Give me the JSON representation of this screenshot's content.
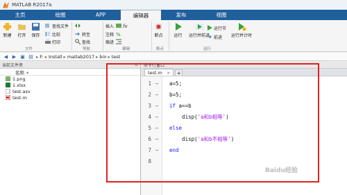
{
  "window": {
    "title": "MATLAB R2017a"
  },
  "tabs": [
    {
      "label": "主页",
      "active": false
    },
    {
      "label": "绘图",
      "active": false
    },
    {
      "label": "APP",
      "active": false
    },
    {
      "label": "编辑器",
      "active": true
    },
    {
      "label": "发布",
      "active": false
    },
    {
      "label": "视图",
      "active": false
    }
  ],
  "ribbon": {
    "new": "新建",
    "open": "打开",
    "save": "保存",
    "find_files": "查找文件",
    "compare": "比较",
    "print": "打印",
    "goto": "转至",
    "find": "查找",
    "insert": "插入",
    "comment": "注释",
    "indent": "缩进",
    "breakpoints": "断点",
    "run": "运行",
    "run_advance": "运行并前进",
    "run_section": "运行节",
    "advance": "前进",
    "run_time": "运行并计时",
    "group_file": "文件",
    "group_nav": "导航",
    "group_edit": "编辑",
    "group_bp": "断点",
    "group_run": "运行"
  },
  "address": {
    "crumbs": [
      "F:",
      "Install",
      "matlab2017",
      "bin",
      "test"
    ]
  },
  "file_panel": {
    "header": "当前文件夹",
    "column": "名称",
    "sort_indicator": "▴",
    "files": [
      {
        "name": "1.png",
        "icon": "image-icon"
      },
      {
        "name": "1.xlsx",
        "icon": "excel-icon"
      },
      {
        "name": "test.asv",
        "icon": "file-icon"
      },
      {
        "name": "test.m",
        "icon": "mfile-icon"
      }
    ]
  },
  "command_window": {
    "header": "命令行窗口"
  },
  "editor": {
    "tab_label": "test.m",
    "close_glyph": "×",
    "add_glyph": "+",
    "lines": [
      {
        "num": "1",
        "dash": "—",
        "code": "a=5;"
      },
      {
        "num": "2",
        "dash": "—",
        "code": "b=5;"
      },
      {
        "num": "3",
        "dash": "—",
        "kw": "if",
        "code": " a==b"
      },
      {
        "num": "4",
        "dash": "—",
        "code": "    disp(",
        "str": "'a和b相等'",
        "tail": ")"
      },
      {
        "num": "5",
        "dash": "—",
        "kw": "else",
        "code": ""
      },
      {
        "num": "6",
        "dash": "—",
        "code": "    disp(",
        "str": "'a和b不相等'",
        "tail": ")"
      },
      {
        "num": "7",
        "dash": "—",
        "kw": "end",
        "code": ""
      },
      {
        "num": "8",
        "dash": "",
        "code": ""
      }
    ]
  },
  "colors": {
    "tabbar": "#1f5f9c",
    "keyword": "#1a1aff",
    "string": "#a020f0",
    "highlight_box": "#e02020"
  },
  "watermark": "Baidu经验"
}
